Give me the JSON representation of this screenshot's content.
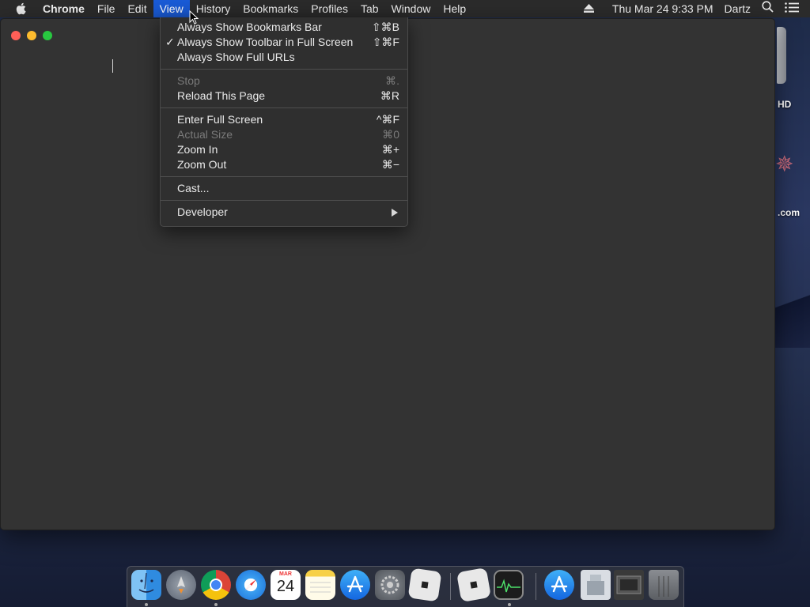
{
  "menubar": {
    "app_name": "Chrome",
    "items": [
      {
        "label": "File"
      },
      {
        "label": "Edit"
      },
      {
        "label": "View"
      },
      {
        "label": "History"
      },
      {
        "label": "Bookmarks"
      },
      {
        "label": "Profiles"
      },
      {
        "label": "Tab"
      },
      {
        "label": "Window"
      },
      {
        "label": "Help"
      }
    ],
    "active_item": "View",
    "datetime": "Thu Mar 24  9:33 PM",
    "user": "Dartz"
  },
  "desktop": {
    "items": [
      {
        "label": "HD"
      },
      {
        "label": ".com"
      }
    ]
  },
  "view_menu": {
    "items": [
      {
        "label": "Always Show Bookmarks Bar",
        "shortcut": "⇧⌘B",
        "checked": false,
        "enabled": true
      },
      {
        "label": "Always Show Toolbar in Full Screen",
        "shortcut": "⇧⌘F",
        "checked": true,
        "enabled": true
      },
      {
        "label": "Always Show Full URLs",
        "shortcut": "",
        "checked": false,
        "enabled": true
      },
      {
        "label": "Stop",
        "shortcut": "⌘.",
        "checked": false,
        "enabled": false
      },
      {
        "label": "Reload This Page",
        "shortcut": "⌘R",
        "checked": false,
        "enabled": true
      },
      {
        "label": "Enter Full Screen",
        "shortcut": "^⌘F",
        "checked": false,
        "enabled": true
      },
      {
        "label": "Actual Size",
        "shortcut": "⌘0",
        "checked": false,
        "enabled": false
      },
      {
        "label": "Zoom In",
        "shortcut": "⌘+",
        "checked": false,
        "enabled": true
      },
      {
        "label": "Zoom Out",
        "shortcut": "⌘−",
        "checked": false,
        "enabled": true
      },
      {
        "label": "Cast...",
        "shortcut": "",
        "checked": false,
        "enabled": true
      },
      {
        "label": "Developer",
        "shortcut": "",
        "checked": false,
        "enabled": true,
        "submenu": true
      }
    ],
    "check_glyph": "✓"
  },
  "dock": {
    "apps": [
      {
        "icon": "finder-icon",
        "running": true
      },
      {
        "icon": "launchpad-icon",
        "running": false
      },
      {
        "icon": "chrome-icon",
        "running": true
      },
      {
        "icon": "safari-icon",
        "running": false
      },
      {
        "icon": "calendar-icon",
        "running": false,
        "month": "MAR",
        "day": "24"
      },
      {
        "icon": "notes-icon",
        "running": false
      },
      {
        "icon": "app-store-icon",
        "running": false
      },
      {
        "icon": "system-preferences-icon",
        "running": false
      },
      {
        "icon": "roblox-icon",
        "running": false
      },
      {
        "icon": "roblox-studio-icon",
        "running": false
      },
      {
        "icon": "activity-monitor-icon",
        "running": true
      },
      {
        "icon": "app-store-download-icon",
        "running": false
      },
      {
        "icon": "preview-icon",
        "running": false
      },
      {
        "icon": "folder-stack-icon",
        "running": false
      },
      {
        "icon": "trash-icon",
        "running": false
      }
    ]
  },
  "colors": {
    "menubar_bg": "#2b2b2b",
    "menu_highlight": "#1a5bd6",
    "window_bg": "#333333",
    "menu_bg": "#2f2f2f",
    "disabled_text": "#7a7a7a"
  }
}
